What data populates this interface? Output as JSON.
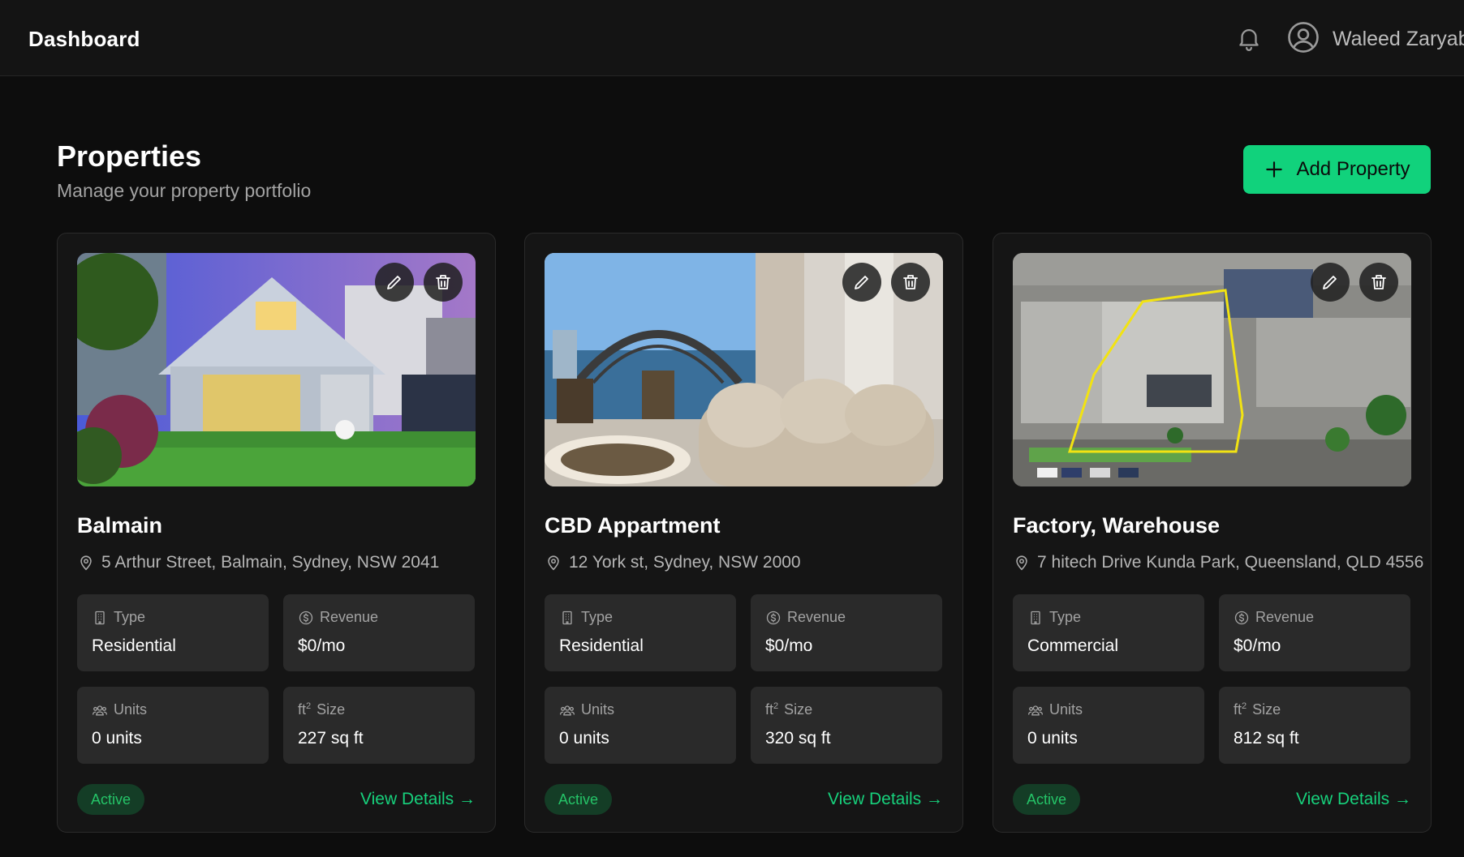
{
  "header": {
    "title": "Dashboard",
    "user_name": "Waleed Zaryab",
    "icons": [
      "bell-icon",
      "user-avatar-icon"
    ]
  },
  "page": {
    "title": "Properties",
    "subtitle": "Manage your property portfolio",
    "add_button_label": "Add Property"
  },
  "labels": {
    "type": "Type",
    "revenue": "Revenue",
    "units": "Units",
    "size": "Size",
    "size_unit_prefix": "ft",
    "size_unit_sup": "2"
  },
  "colors": {
    "accent": "#11d27c",
    "background": "#0d0d0d",
    "card": "#151515",
    "stat_box": "#2a2a2a",
    "badge_bg": "#143d26",
    "badge_text": "#25c468"
  },
  "properties": [
    {
      "name": "Balmain",
      "address": "5 Arthur Street, Balmain, Sydney, NSW 2041",
      "type": "Residential",
      "revenue": "$0/mo",
      "units": "0 units",
      "size": "227 sq ft",
      "status": "Active",
      "link": "View Details →"
    },
    {
      "name": "CBD Appartment",
      "address": "12 York st, Sydney, NSW 2000",
      "type": "Residential",
      "revenue": "$0/mo",
      "units": "0 units",
      "size": "320 sq ft",
      "status": "Active",
      "link": "View Details →"
    },
    {
      "name": "Factory, Warehouse",
      "address": "7 hitech Drive Kunda Park, Queensland, QLD 4556",
      "type": "Commercial",
      "revenue": "$0/mo",
      "units": "0 units",
      "size": "812 sq ft",
      "status": "Active",
      "link": "View Details →"
    }
  ]
}
